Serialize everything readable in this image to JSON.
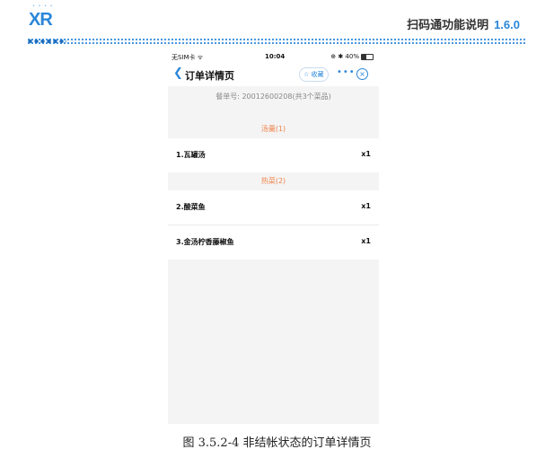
{
  "doc": {
    "logo_text": "XR",
    "title": "扫码通功能说明",
    "version": "1.6.0"
  },
  "status": {
    "carrier": "无SIM卡 ᯤ",
    "time": "10:04",
    "right": "⊕ ✱ 40%",
    "battery_level": 0.4
  },
  "nav": {
    "back_icon": "chevron-left-icon",
    "title": "订单详情页",
    "fav_label": "☆ 收藏",
    "more": "•••",
    "close": "×"
  },
  "order": {
    "number_text": "餐单号: 20012600208(共3个菜品)"
  },
  "categories": [
    {
      "label": "汤羹(1)"
    },
    {
      "label": "热菜(2)"
    }
  ],
  "dishes": [
    {
      "name": "1.瓦罐汤",
      "qty": "x1"
    },
    {
      "name": "2.酸菜鱼",
      "qty": "x1"
    },
    {
      "name": "3.金汤柠香藤椒鱼",
      "qty": "x1"
    }
  ],
  "caption": "图 3.5.2-4  非结帐状态的订单详情页",
  "colors": {
    "accent": "#2a86d8",
    "category": "#f0824a"
  }
}
